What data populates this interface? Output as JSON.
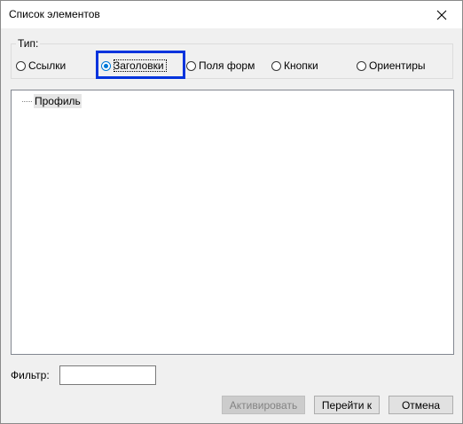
{
  "window": {
    "title": "Список элементов"
  },
  "icons": {
    "close": "close-icon"
  },
  "type_group": {
    "legend": "Тип:",
    "options": [
      {
        "label": "Ссылки",
        "checked": false
      },
      {
        "label": "Заголовки",
        "checked": true
      },
      {
        "label": "Поля форм",
        "checked": false
      },
      {
        "label": "Кнопки",
        "checked": false
      },
      {
        "label": "Ориентиры",
        "checked": false
      }
    ]
  },
  "tree": {
    "items": [
      {
        "label": "Профиль"
      }
    ]
  },
  "filter": {
    "label": "Фильтр:",
    "value": ""
  },
  "buttons": {
    "activate": "Активировать",
    "goto": "Перейти к",
    "cancel": "Отмена"
  },
  "colors": {
    "accent": "#0078d7",
    "focus_highlight": "#0033dd"
  }
}
